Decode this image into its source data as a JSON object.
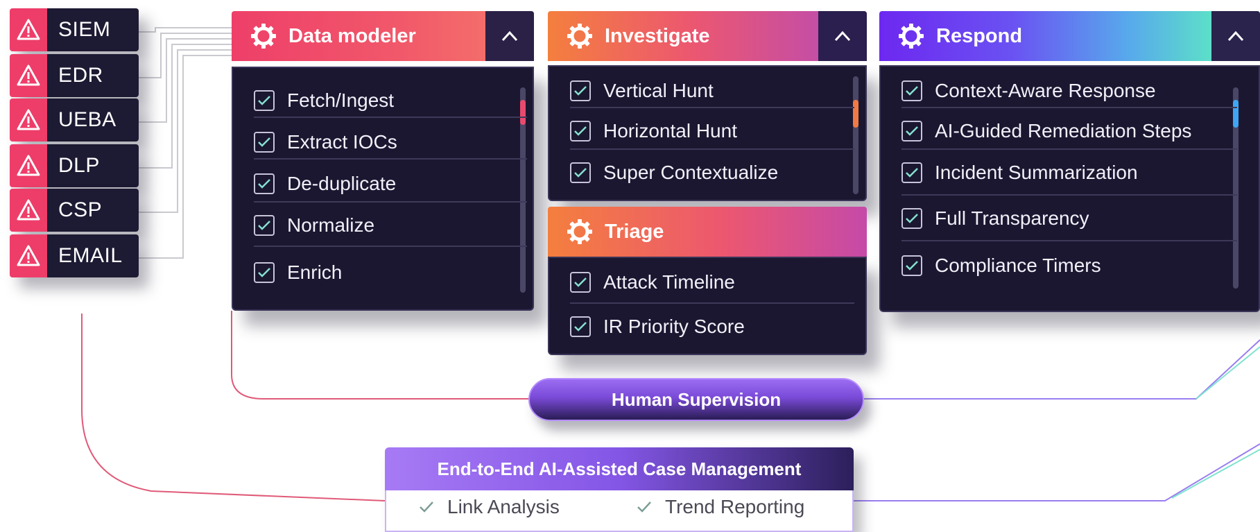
{
  "sources": [
    {
      "label": "SIEM"
    },
    {
      "label": "EDR"
    },
    {
      "label": "UEBA"
    },
    {
      "label": "DLP"
    },
    {
      "label": "CSP"
    },
    {
      "label": "EMAIL"
    }
  ],
  "panels": {
    "data_modeler": {
      "title": "Data modeler",
      "items": [
        "Fetch/Ingest",
        "Extract IOCs",
        "De-duplicate",
        "Normalize",
        "Enrich"
      ]
    },
    "investigate": {
      "title": "Investigate",
      "items": [
        "Vertical Hunt",
        "Horizontal Hunt",
        "Super Contextualize"
      ]
    },
    "triage": {
      "title": "Triage",
      "items": [
        "Attack Timeline",
        "IR Priority Score"
      ]
    },
    "respond": {
      "title": "Respond",
      "items": [
        "Context-Aware Response",
        "AI-Guided Remediation Steps",
        "Incident Summarization",
        "Full Transparency",
        "Compliance Timers"
      ]
    }
  },
  "human_supervision": {
    "label": "Human Supervision"
  },
  "case_management": {
    "title": "End-to-End AI-Assisted Case Management",
    "items": [
      "Link Analysis",
      "Trend Reporting"
    ]
  },
  "colors": {
    "alert": "#ee3d69",
    "panel_bg": "#1b1731",
    "accent_purple": "#8456e6",
    "accent_teal": "#5de6c4"
  },
  "icons": {
    "source": "warning-triangle-icon",
    "panel": "gear-icon",
    "toggle": "chevron-up-icon",
    "item": "checkbox-checked-icon"
  }
}
